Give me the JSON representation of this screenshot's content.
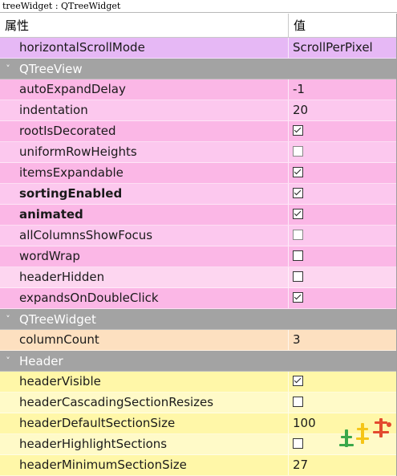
{
  "window": {
    "title": "treeWidget : QTreeWidget"
  },
  "header": {
    "property_col": "属性",
    "value_col": "值"
  },
  "rows": [
    {
      "kind": "prop",
      "name": "horizontalScrollMode",
      "value": "ScrollPerPixel",
      "color": "#e6b8f5"
    },
    {
      "kind": "group",
      "name": "QTreeView",
      "icon": "chevron-down-icon"
    },
    {
      "kind": "prop",
      "name": "autoExpandDelay",
      "value": "-1",
      "color": "#fbb7e6"
    },
    {
      "kind": "prop",
      "name": "indentation",
      "value": "20",
      "color": "#fcc8ee"
    },
    {
      "kind": "prop",
      "name": "rootIsDecorated",
      "checkbox": true,
      "checked": true,
      "color": "#fbb7e6"
    },
    {
      "kind": "prop",
      "name": "uniformRowHeights",
      "checkbox": true,
      "checked": false,
      "color": "#fcc8ee"
    },
    {
      "kind": "prop",
      "name": "itemsExpandable",
      "checkbox": true,
      "checked": true,
      "color": "#fbb7e6"
    },
    {
      "kind": "prop",
      "name": "sortingEnabled",
      "checkbox": true,
      "checked": true,
      "bold": true,
      "color": "#fcc8ee"
    },
    {
      "kind": "prop",
      "name": "animated",
      "checkbox": true,
      "checked": true,
      "bold": true,
      "color": "#fbb7e6"
    },
    {
      "kind": "prop",
      "name": "allColumnsShowFocus",
      "checkbox": true,
      "checked": false,
      "color": "#fcc8ee"
    },
    {
      "kind": "prop",
      "name": "wordWrap",
      "checkbox": true,
      "checked": false,
      "color": "#fbb7e6"
    },
    {
      "kind": "prop",
      "name": "headerHidden",
      "checkbox": true,
      "checked": false,
      "color": "#fdd6f0"
    },
    {
      "kind": "prop",
      "name": "expandsOnDoubleClick",
      "checkbox": true,
      "checked": true,
      "color": "#fbb7e6"
    },
    {
      "kind": "group",
      "name": "QTreeWidget",
      "icon": "chevron-down-icon"
    },
    {
      "kind": "prop",
      "name": "columnCount",
      "value": "3",
      "color": "#fde0c0"
    },
    {
      "kind": "group",
      "name": "Header",
      "icon": "chevron-down-icon"
    },
    {
      "kind": "prop",
      "name": "headerVisible",
      "checkbox": true,
      "checked": true,
      "color": "#fff7a8"
    },
    {
      "kind": "prop",
      "name": "headerCascadingSectionResizes",
      "checkbox": true,
      "checked": false,
      "color": "#fffac8"
    },
    {
      "kind": "prop",
      "name": "headerDefaultSectionSize",
      "value": "100",
      "color": "#fff7a8"
    },
    {
      "kind": "prop",
      "name": "headerHighlightSections",
      "checkbox": true,
      "checked": false,
      "color": "#fffac8"
    },
    {
      "kind": "prop",
      "name": "headerMinimumSectionSize",
      "value": "27",
      "color": "#fff7a8"
    }
  ]
}
